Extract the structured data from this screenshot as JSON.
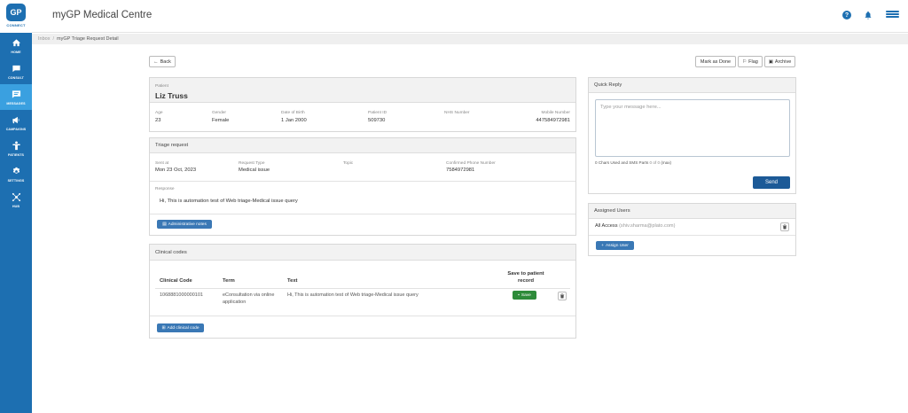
{
  "brand": {
    "logo_text": "GP",
    "logo_sub": "CONNECT",
    "app_title": "myGP Medical Centre"
  },
  "sidebar": {
    "items": [
      {
        "label": "HOME",
        "icon": "home-icon"
      },
      {
        "label": "CONSULT",
        "icon": "chat-icon"
      },
      {
        "label": "MESSAGES",
        "icon": "message-icon"
      },
      {
        "label": "CAMPAIGNS",
        "icon": "megaphone-icon"
      },
      {
        "label": "PATIENTS",
        "icon": "person-icon"
      },
      {
        "label": "SETTINGS",
        "icon": "gear-icon"
      },
      {
        "label": "HUB",
        "icon": "hub-icon"
      }
    ]
  },
  "breadcrumb": {
    "root": "Inbox",
    "separator": "/",
    "current": "myGP Triage Request Detail"
  },
  "toolbar": {
    "back": "Back",
    "mark_done": "Mark as Done",
    "flag": "Flag",
    "archive": "Archive"
  },
  "patient": {
    "header_label": "Patient",
    "name": "Liz Truss",
    "fields": [
      {
        "label": "Age",
        "value": "23"
      },
      {
        "label": "Gender",
        "value": "Female"
      },
      {
        "label": "Date of Birth",
        "value": "1 Jan 2000"
      },
      {
        "label": "Patient ID",
        "value": "509730"
      },
      {
        "label": "NHS Number",
        "value": ""
      },
      {
        "label": "Mobile Number",
        "value": "447584972981"
      }
    ]
  },
  "triage": {
    "title": "Triage request",
    "fields": [
      {
        "label": "Sent at",
        "value": "Mon 23 Oct, 2023"
      },
      {
        "label": "Request Type",
        "value": "Medical issue"
      },
      {
        "label": "Topic",
        "value": ""
      },
      {
        "label": "Confirmed Phone Number",
        "value": "7584972981"
      }
    ],
    "response_label": "Response",
    "response_text": "Hi, This is automation test of Web triage-Medical issue query",
    "admin_notes_button": "Administrative notes"
  },
  "clinical": {
    "title": "Clinical codes",
    "headers": {
      "code": "Clinical Code",
      "term": "Term",
      "text": "Text",
      "save": "Save to patient record"
    },
    "rows": [
      {
        "code": "1068881000000101",
        "term": "eConsultation via online application",
        "text": "Hi, This is automation test of Web triage-Medical issue query",
        "save_label": "Save"
      }
    ],
    "add_button": "Add clinical code"
  },
  "quick_reply": {
    "title": "Quick Reply",
    "placeholder": "Type your message here...",
    "counter_prefix": "0 Chars Used and SMS Parts",
    "counter_parts": "0 of 0",
    "counter_suffix": "(max)",
    "send": "Send"
  },
  "assigned": {
    "title": "Assigned Users",
    "user": "All Access",
    "email": "(shiv.sharma@plato.com)",
    "assign_button": "Assign User"
  },
  "colors": {
    "primary": "#1d6fb1",
    "active_nav": "#3aa0e0",
    "save_green": "#2e8b3a",
    "send_blue": "#1c5a97"
  }
}
